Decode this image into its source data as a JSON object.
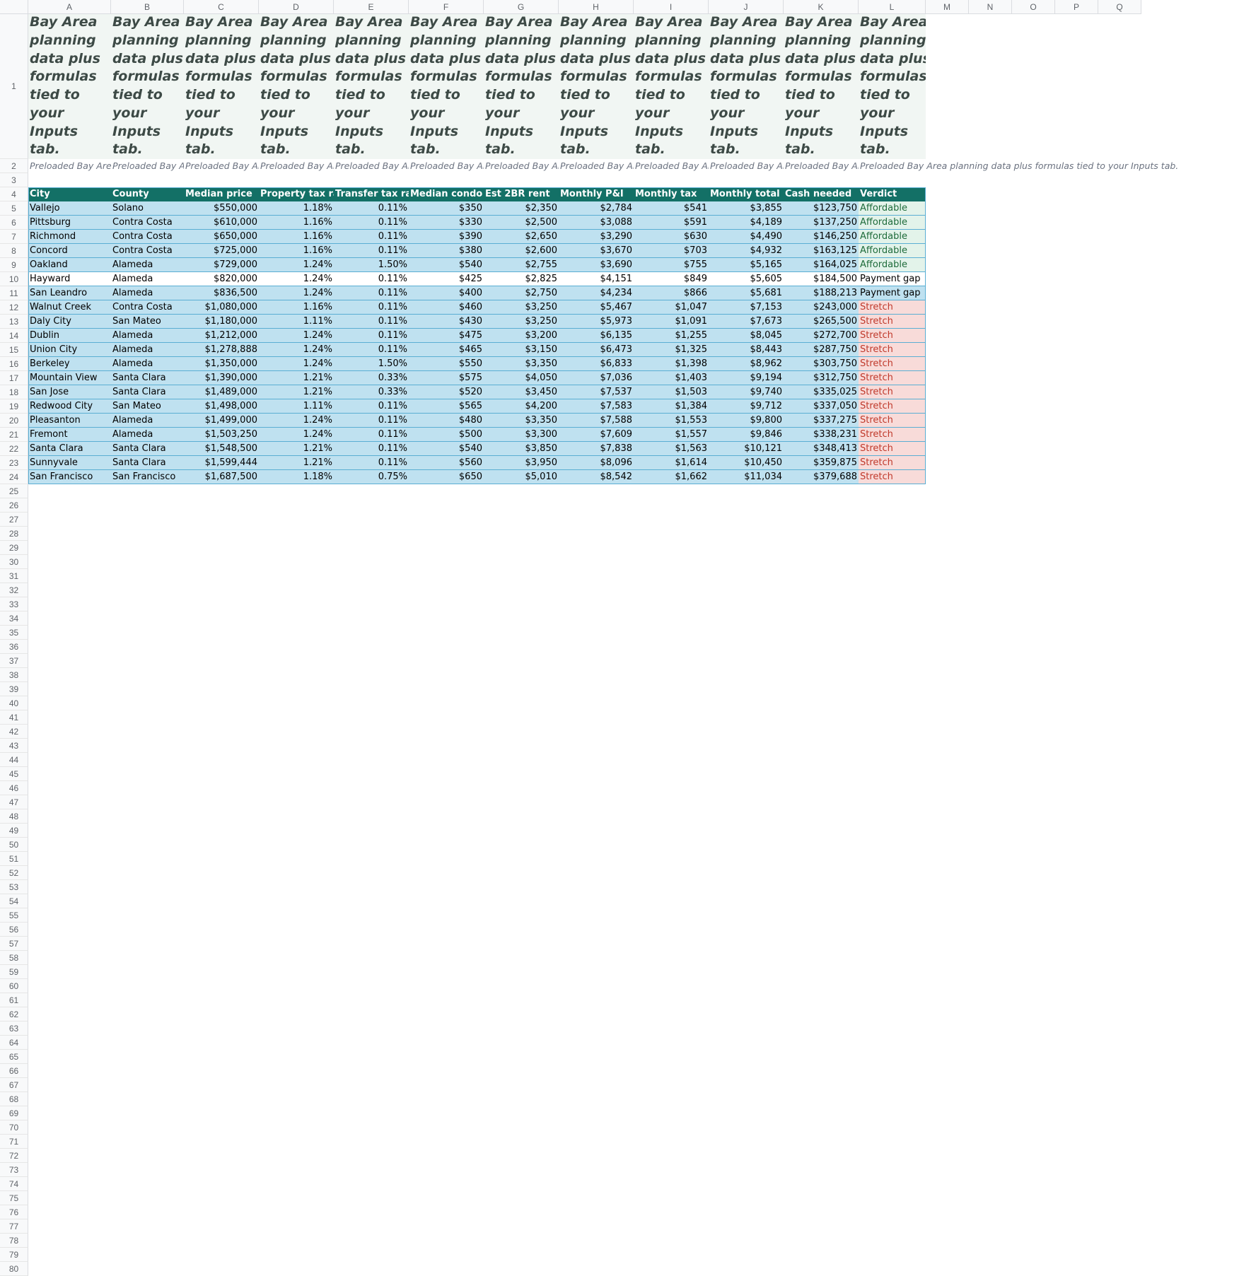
{
  "columns": [
    "A",
    "B",
    "C",
    "D",
    "E",
    "F",
    "G",
    "H",
    "I",
    "J",
    "K",
    "L",
    "M",
    "N",
    "O",
    "P",
    "Q"
  ],
  "title_text": "Preloaded Bay Area planning data plus formulas tied to your Inputs tab.",
  "subtitle_text": "Preloaded Bay Area planning data plus formulas tied to your Inputs tab.",
  "headers": [
    "City",
    "County",
    "Median price",
    "Property tax rate",
    "Transfer tax rate",
    "Median condo HOA",
    "Est 2BR rent",
    "Monthly P&I",
    "Monthly tax",
    "Monthly total",
    "Cash needed",
    "Verdict"
  ],
  "rows": [
    [
      "Vallejo",
      "Solano",
      "$550,000",
      "1.18%",
      "0.11%",
      "$350",
      "$2,350",
      "$2,784",
      "$541",
      "$3,855",
      "$123,750",
      "Affordable"
    ],
    [
      "Pittsburg",
      "Contra Costa",
      "$610,000",
      "1.16%",
      "0.11%",
      "$330",
      "$2,500",
      "$3,088",
      "$591",
      "$4,189",
      "$137,250",
      "Affordable"
    ],
    [
      "Richmond",
      "Contra Costa",
      "$650,000",
      "1.16%",
      "0.11%",
      "$390",
      "$2,650",
      "$3,290",
      "$630",
      "$4,490",
      "$146,250",
      "Affordable"
    ],
    [
      "Concord",
      "Contra Costa",
      "$725,000",
      "1.16%",
      "0.11%",
      "$380",
      "$2,600",
      "$3,670",
      "$703",
      "$4,932",
      "$163,125",
      "Affordable"
    ],
    [
      "Oakland",
      "Alameda",
      "$729,000",
      "1.24%",
      "1.50%",
      "$540",
      "$2,755",
      "$3,690",
      "$755",
      "$5,165",
      "$164,025",
      "Affordable"
    ],
    [
      "Hayward",
      "Alameda",
      "$820,000",
      "1.24%",
      "0.11%",
      "$425",
      "$2,825",
      "$4,151",
      "$849",
      "$5,605",
      "$184,500",
      "Payment gap"
    ],
    [
      "San Leandro",
      "Alameda",
      "$836,500",
      "1.24%",
      "0.11%",
      "$400",
      "$2,750",
      "$4,234",
      "$866",
      "$5,681",
      "$188,213",
      "Payment gap"
    ],
    [
      "Walnut Creek",
      "Contra Costa",
      "$1,080,000",
      "1.16%",
      "0.11%",
      "$460",
      "$3,250",
      "$5,467",
      "$1,047",
      "$7,153",
      "$243,000",
      "Stretch"
    ],
    [
      "Daly City",
      "San Mateo",
      "$1,180,000",
      "1.11%",
      "0.11%",
      "$430",
      "$3,250",
      "$5,973",
      "$1,091",
      "$7,673",
      "$265,500",
      "Stretch"
    ],
    [
      "Dublin",
      "Alameda",
      "$1,212,000",
      "1.24%",
      "0.11%",
      "$475",
      "$3,200",
      "$6,135",
      "$1,255",
      "$8,045",
      "$272,700",
      "Stretch"
    ],
    [
      "Union City",
      "Alameda",
      "$1,278,888",
      "1.24%",
      "0.11%",
      "$465",
      "$3,150",
      "$6,473",
      "$1,325",
      "$8,443",
      "$287,750",
      "Stretch"
    ],
    [
      "Berkeley",
      "Alameda",
      "$1,350,000",
      "1.24%",
      "1.50%",
      "$550",
      "$3,350",
      "$6,833",
      "$1,398",
      "$8,962",
      "$303,750",
      "Stretch"
    ],
    [
      "Mountain View",
      "Santa Clara",
      "$1,390,000",
      "1.21%",
      "0.33%",
      "$575",
      "$4,050",
      "$7,036",
      "$1,403",
      "$9,194",
      "$312,750",
      "Stretch"
    ],
    [
      "San Jose",
      "Santa Clara",
      "$1,489,000",
      "1.21%",
      "0.33%",
      "$520",
      "$3,450",
      "$7,537",
      "$1,503",
      "$9,740",
      "$335,025",
      "Stretch"
    ],
    [
      "Redwood City",
      "San Mateo",
      "$1,498,000",
      "1.11%",
      "0.11%",
      "$565",
      "$4,200",
      "$7,583",
      "$1,384",
      "$9,712",
      "$337,050",
      "Stretch"
    ],
    [
      "Pleasanton",
      "Alameda",
      "$1,499,000",
      "1.24%",
      "0.11%",
      "$480",
      "$3,350",
      "$7,588",
      "$1,553",
      "$9,800",
      "$337,275",
      "Stretch"
    ],
    [
      "Fremont",
      "Alameda",
      "$1,503,250",
      "1.24%",
      "0.11%",
      "$500",
      "$3,300",
      "$7,609",
      "$1,557",
      "$9,846",
      "$338,231",
      "Stretch"
    ],
    [
      "Santa Clara",
      "Santa Clara",
      "$1,548,500",
      "1.21%",
      "0.11%",
      "$540",
      "$3,850",
      "$7,838",
      "$1,563",
      "$10,121",
      "$348,413",
      "Stretch"
    ],
    [
      "Sunnyvale",
      "Santa Clara",
      "$1,599,444",
      "1.21%",
      "0.11%",
      "$560",
      "$3,950",
      "$8,096",
      "$1,614",
      "$10,450",
      "$359,875",
      "Stretch"
    ],
    [
      "San Francisco",
      "San Francisco",
      "$1,687,500",
      "1.18%",
      "0.75%",
      "$650",
      "$5,010",
      "$8,542",
      "$1,662",
      "$11,034",
      "$379,688",
      "Stretch"
    ]
  ],
  "row_count": 80,
  "colors": {
    "header_bg": "#137066",
    "row_band": "#bfe1f0",
    "affordable_bg": "#e3f3ea",
    "stretch_bg": "#f8dbd9",
    "stretch_text": "#c0392b"
  }
}
